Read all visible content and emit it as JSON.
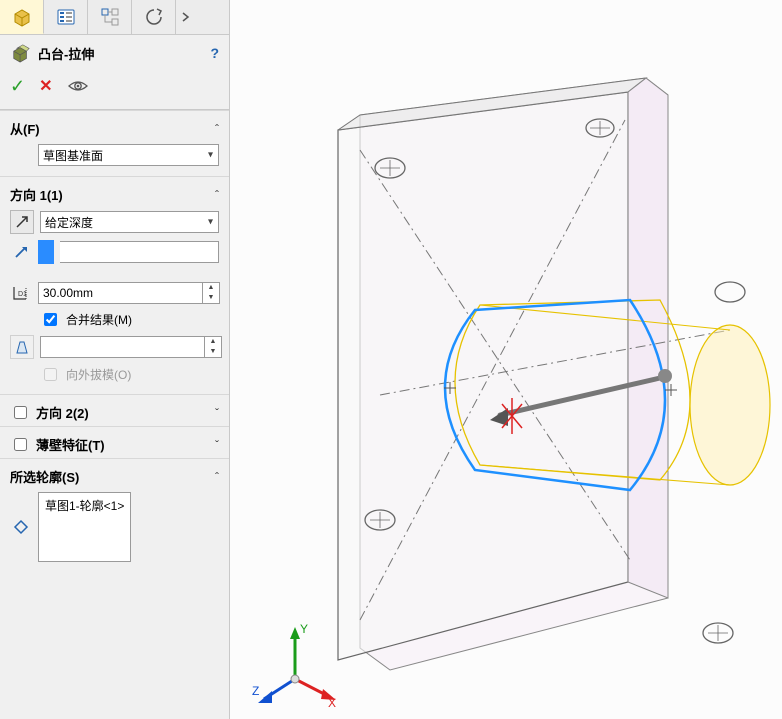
{
  "feature": {
    "title": "凸台-拉伸",
    "help_tooltip": "?"
  },
  "actions": {
    "ok": "✓",
    "cancel": "✕"
  },
  "from_section": {
    "label": "从(F)",
    "select_value": "草图基准面"
  },
  "direction1_section": {
    "label": "方向 1(1)",
    "end_condition": "给定深度",
    "depth_value": "30.00mm",
    "merge_label": "合并结果(M)",
    "merge_checked": true,
    "draft_label": "向外拔模(O)",
    "draft_checked": false,
    "draft_disabled": true
  },
  "direction2_section": {
    "label": "方向 2(2)",
    "checked": false
  },
  "thin_section": {
    "label": "薄壁特征(T)",
    "checked": false
  },
  "contours_section": {
    "label": "所选轮廓(S)",
    "item": "草图1-轮廓<1>"
  },
  "triad": {
    "x": "X",
    "y": "Y",
    "z": "Z"
  }
}
